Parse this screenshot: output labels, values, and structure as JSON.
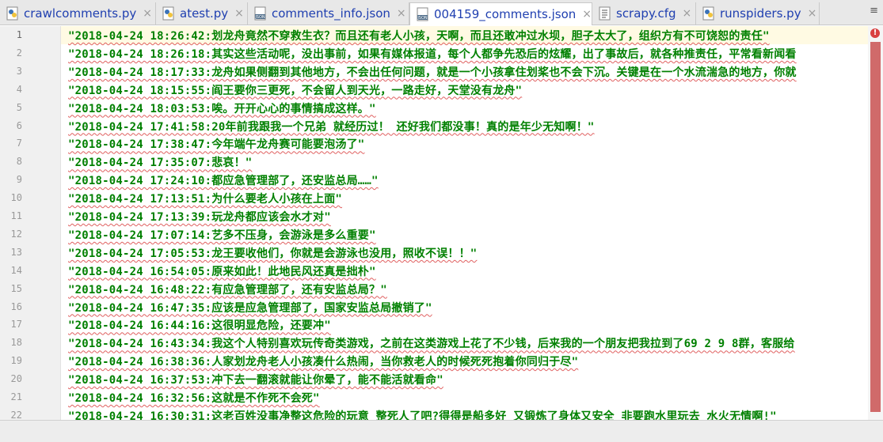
{
  "tabs": [
    {
      "label": "crawlcomments.py",
      "icon": "python-file-icon",
      "active": false
    },
    {
      "label": "atest.py",
      "icon": "python-file-icon",
      "active": false
    },
    {
      "label": "comments_info.json",
      "icon": "json-file-icon",
      "active": false
    },
    {
      "label": "004159_comments.json",
      "icon": "json-file-icon",
      "active": true
    },
    {
      "label": "scrapy.cfg",
      "icon": "config-file-icon",
      "active": false
    },
    {
      "label": "runspiders.py",
      "icon": "python-file-icon",
      "active": false
    }
  ],
  "tab_close_glyph": "×",
  "tab_menu_glyph": "≡",
  "error_glyph": "!",
  "line_numbers": [
    "1",
    "2",
    "3",
    "4",
    "5",
    "6",
    "7",
    "8",
    "9",
    "10",
    "11",
    "12",
    "13",
    "14",
    "15",
    "16",
    "17",
    "18",
    "19",
    "20",
    "21",
    "22"
  ],
  "lines": [
    "\"2018-04-24 18:26:42:划龙舟竟然不穿救生衣？而且还有老人小孩，天啊，而且还敢冲过水坝，胆子太大了，组织方有不可饶恕的责任\"",
    "\"2018-04-24 18:26:18:其实这些活动呢，没出事前，如果有媒体报道，每个人都争先恐后的炫耀，出了事故后，就各种推责任，平常看新闻看",
    "\"2018-04-24 18:17:33:龙舟如果侧翻到其他地方，不会出任何问题，就是一个小孩拿住划桨也不会下沉。关键是在一个水流湍急的地方，你就",
    "\"2018-04-24 18:15:55:阎王要你三更死，不会留人到天光，一路走好，天堂没有龙舟\"",
    "\"2018-04-24 18:03:53:唉。开开心心的事情搞成这样。\"",
    "\"2018-04-24 17:41:58:20年前我跟我一个兄弟 就经历过！ 还好我们都没事！真的是年少无知啊！\"",
    "\"2018-04-24 17:38:47:今年端午龙舟赛可能要泡汤了\"",
    "\"2018-04-24 17:35:07:悲哀！\"",
    "\"2018-04-24 17:24:10:都应急管理部了，还安监总局……\"",
    "\"2018-04-24 17:13:51:为什么要老人小孩在上面\"",
    "\"2018-04-24 17:13:39:玩龙舟都应该会水才对\"",
    "\"2018-04-24 17:07:14:艺多不压身，会游泳是多么重要\"",
    "\"2018-04-24 17:05:53:龙王要收他们，你就是会游泳也没用，照收不误！！\"",
    "\"2018-04-24 16:54:05:原来如此！此地民风还真是拙朴\"",
    "\"2018-04-24 16:48:22:有应急管理部了，还有安监总局？\"",
    "\"2018-04-24 16:47:35:应该是应急管理部了，国家安监总局撤销了\"",
    "\"2018-04-24 16:44:16:这很明显危险，还要冲\"",
    "\"2018-04-24 16:43:34:我这个人特别喜欢玩传奇类游戏，之前在这类游戏上花了不少钱，后来我的一个朋友把我拉到了69 2 9 8群，客服给",
    "\"2018-04-24 16:38:36:人家划龙舟老人小孩凑什么热闹，当你救老人的时候死死抱着你同归于尽\"",
    "\"2018-04-24 16:37:53:冲下去一翻滚就能让你晕了，能不能活就看命\"",
    "\"2018-04-24 16:32:56:这就是不作死不会死\"",
    "\"2018-04-24 16:30:31:这老百姓没事净整这危险的玩意 整死人了吧?得得是船多好 又锻炼了身体又安全 非要跑水里玩去 水火无情啊!\""
  ]
}
